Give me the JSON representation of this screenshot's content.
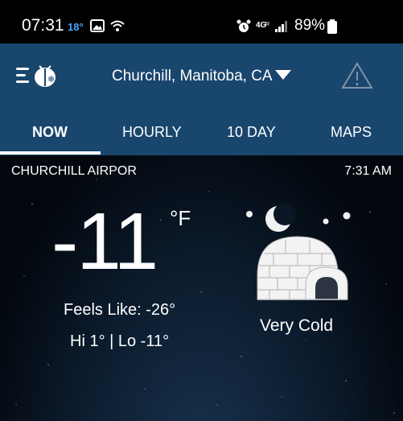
{
  "status_bar": {
    "time": "07:31",
    "temp": "18°",
    "battery": "89%"
  },
  "header": {
    "location": "Churchill, Manitoba, CA",
    "brand_color": "#19466d"
  },
  "tabs": [
    {
      "label": "NOW",
      "active": true
    },
    {
      "label": "HOURLY",
      "active": false
    },
    {
      "label": "10 DAY",
      "active": false
    },
    {
      "label": "MAPS",
      "active": false
    }
  ],
  "current": {
    "station": "CHURCHILL AIRPOR",
    "obs_time": "7:31 AM",
    "temperature": "-11",
    "unit": "°F",
    "feels_like": "Feels Like: -26°",
    "hi_lo": "Hi 1° | Lo -11°",
    "condition": "Very Cold",
    "condition_icon": "igloo-moon-icon"
  }
}
